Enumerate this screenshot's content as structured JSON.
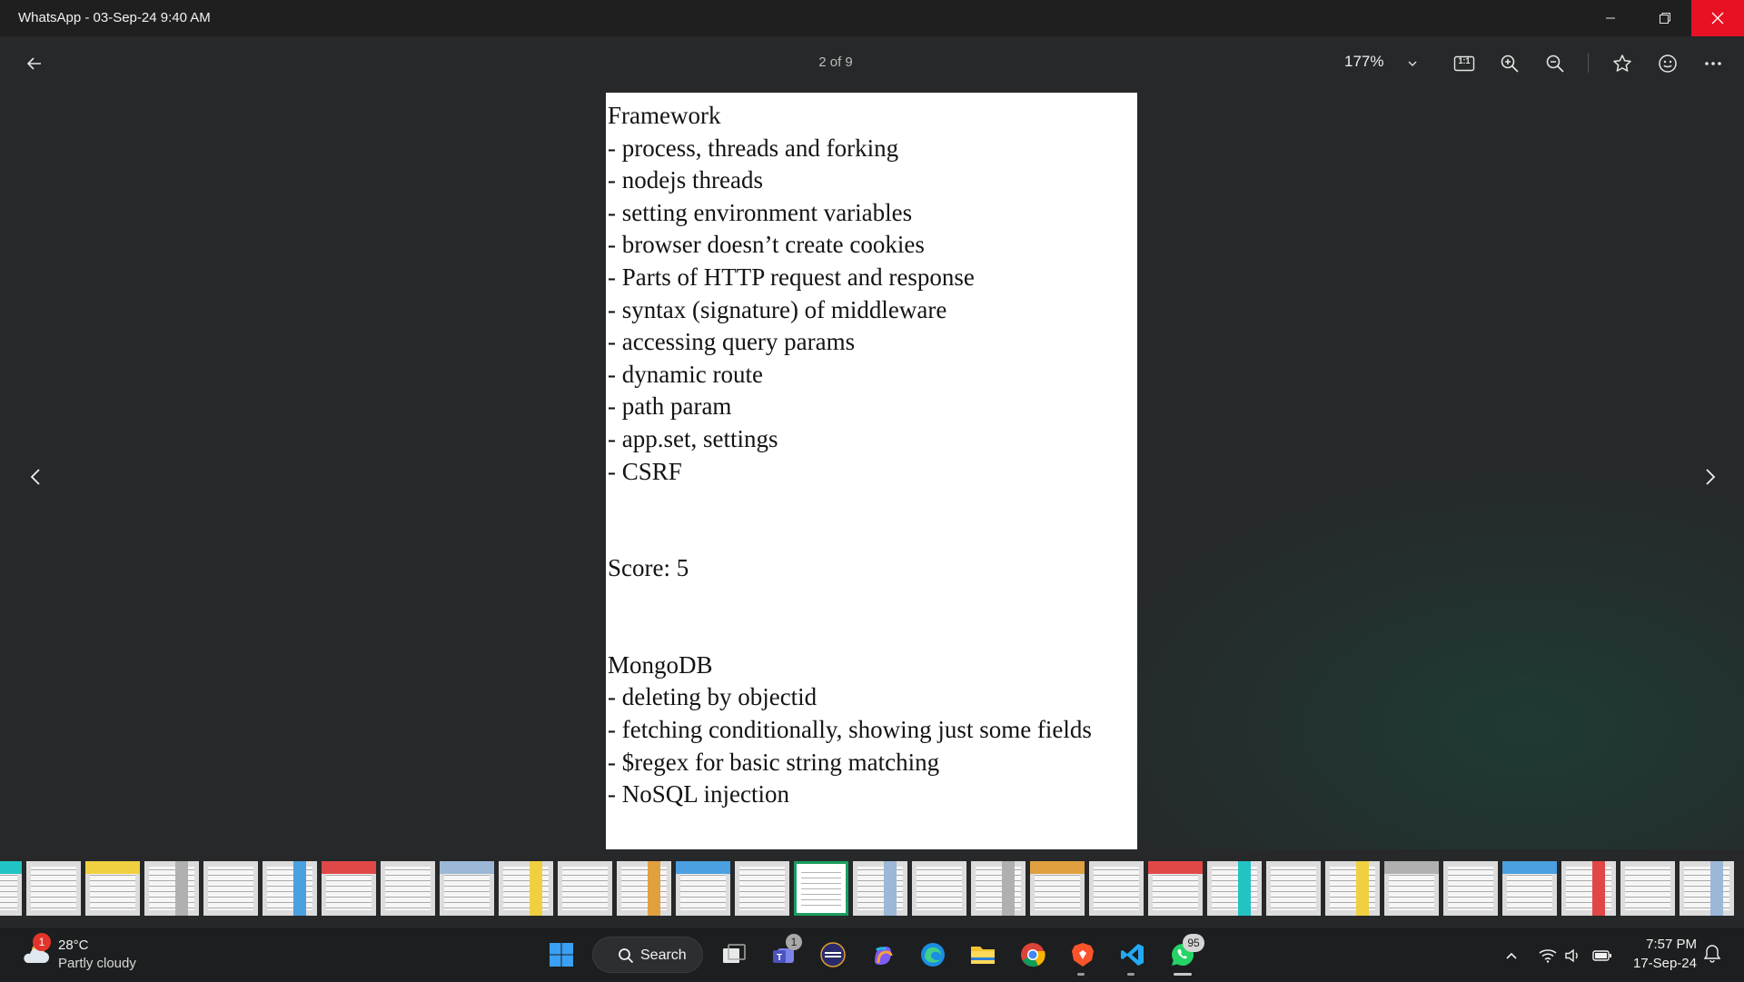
{
  "window": {
    "title": "WhatsApp - 03-Sep-24 9:40 AM"
  },
  "toolbar": {
    "page_counter": "2 of 9",
    "zoom": "177%",
    "actual_size_label": "1:1"
  },
  "document": {
    "sections": [
      {
        "lines": [
          "Framework",
          "- process, threads and forking",
          "- nodejs threads",
          "- setting environment variables",
          "- browser doesn’t create cookies",
          "- Parts of HTTP request and response",
          "- syntax (signature) of middleware",
          "- accessing query params",
          "- dynamic route",
          "- path param",
          "- app.set, settings",
          "- CSRF"
        ]
      },
      {
        "lines": [
          "Score: 5"
        ]
      },
      {
        "lines": [
          "MongoDB",
          "- deleting by objectid",
          "- fetching conditionally, showing just some fields",
          "- $regex for basic string matching",
          "- NoSQL injection"
        ]
      }
    ]
  },
  "thumbnails": {
    "count": 30,
    "active_index": 14
  },
  "taskbar": {
    "weather": {
      "temp": "28°C",
      "desc": "Partly cloudy",
      "badge": "1"
    },
    "search_label": "Search",
    "apps": [
      {
        "name": "start-button",
        "icon": "windows-logo-icon"
      },
      {
        "name": "task-view-button",
        "icon": "task-view-icon"
      },
      {
        "name": "teams-app",
        "icon": "teams-icon",
        "badge": "1"
      },
      {
        "name": "app-circle",
        "icon": "app-circle-icon"
      },
      {
        "name": "copilot-app",
        "icon": "copilot-icon"
      },
      {
        "name": "edge-app",
        "icon": "edge-icon"
      },
      {
        "name": "file-explorer-app",
        "icon": "folder-icon"
      },
      {
        "name": "chrome-app",
        "icon": "chrome-icon"
      },
      {
        "name": "brave-app",
        "icon": "brave-icon"
      },
      {
        "name": "vscode-app",
        "icon": "vscode-icon"
      },
      {
        "name": "whatsapp-app",
        "icon": "whatsapp-icon",
        "badge": "95"
      }
    ],
    "clock": {
      "time": "7:57 PM",
      "date": "17-Sep-24"
    }
  },
  "colors": {
    "background": "#262829",
    "close_button": "#e81123",
    "thumbnail_active_border": "#1a9e60",
    "badge": "#c62828"
  }
}
